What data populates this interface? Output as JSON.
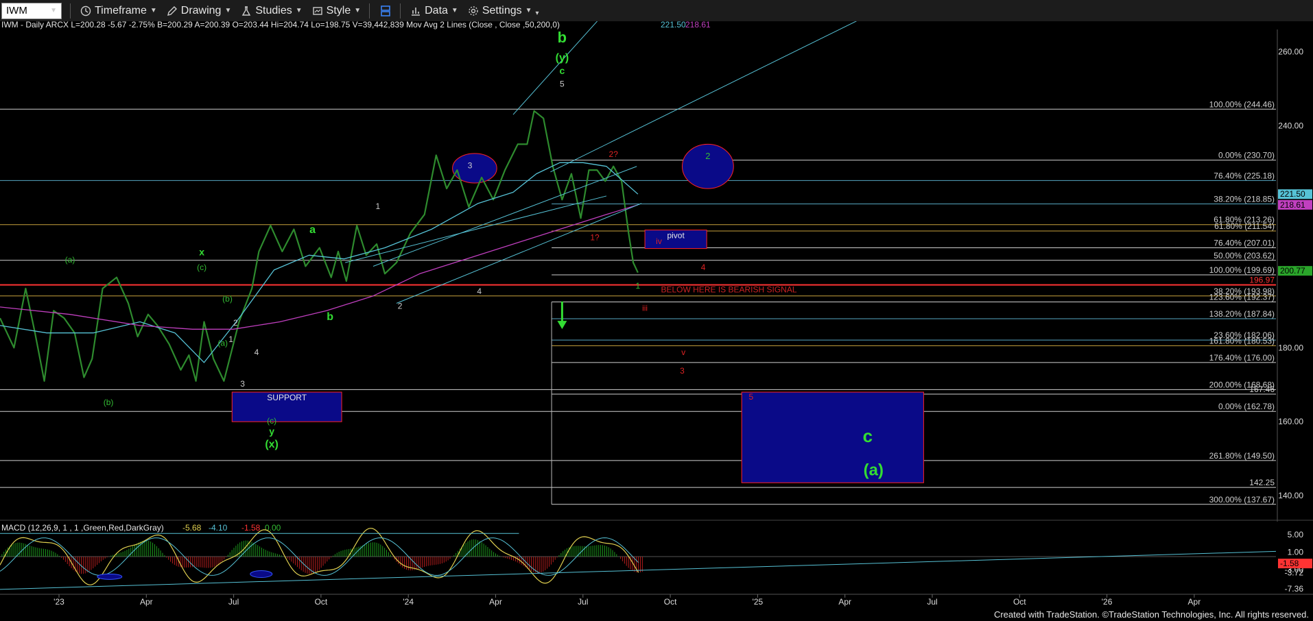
{
  "toolbar": {
    "symbol": "IWM",
    "timeframe_label": "Timeframe",
    "drawing_label": "Drawing",
    "studies_label": "Studies",
    "style_label": "Style",
    "data_label": "Data",
    "settings_label": "Settings"
  },
  "header": {
    "info_text": "IWM - Daily  ARCX  L=200.28  -5.67  -2.75%  B=200.29  A=200.39  O=203.44  Hi=204.74  Lo=198.75  V=39,442,839  Mov Avg 2 Lines (Close , Close ,50,200,0)",
    "ma50": "221.50",
    "ma200": "218.61"
  },
  "macd": {
    "label": "MACD (12,26,9, 1 , 1 ,Green,Red,DarkGray)",
    "v1": "-5.68",
    "v2": "-4.10",
    "v3": "-1.58",
    "v4": "0.00",
    "ticks": [
      "5.00",
      "1.00",
      "-3.72",
      "-3.00",
      "-7.36"
    ],
    "current": "-1.58"
  },
  "footer_text": "Created with TradeStation. ©TradeStation Technologies, Inc. All rights reserved.",
  "colors": {
    "background": "#000000",
    "price": "#2e8b2e",
    "ma50": "#56c2d6",
    "ma200": "#c03fbf",
    "support_fill": "#0a0a88",
    "red_line": "#ff3333"
  },
  "chart_data": {
    "type": "line",
    "title": "IWM - Daily",
    "ylim": [
      133,
      266
    ],
    "y_ticks": [
      260,
      240,
      180,
      160,
      140
    ],
    "x_labels": [
      "'23",
      "Apr",
      "Jul",
      "Oct",
      "'24",
      "Apr",
      "Jul",
      "Oct",
      "'25",
      "Apr",
      "Jul",
      "Oct",
      "'26",
      "Apr"
    ],
    "price_labels": [
      {
        "text": "221.50",
        "value": 221.5,
        "color": "#56c2d6"
      },
      {
        "text": "218.61",
        "value": 218.61,
        "color": "#c03fbf"
      },
      {
        "text": "200.77",
        "value": 200.77,
        "color": "#2aa52a"
      }
    ],
    "series": [
      {
        "name": "IWM",
        "color": "#2e8b2e",
        "points": [
          [
            0,
            188
          ],
          [
            12,
            180
          ],
          [
            22,
            196
          ],
          [
            30,
            184
          ],
          [
            38,
            171
          ],
          [
            46,
            190
          ],
          [
            55,
            188
          ],
          [
            64,
            184
          ],
          [
            72,
            172
          ],
          [
            79,
            177
          ],
          [
            88,
            196
          ],
          [
            100,
            199
          ],
          [
            110,
            192
          ],
          [
            118,
            183
          ],
          [
            127,
            189
          ],
          [
            135,
            186
          ],
          [
            145,
            181
          ],
          [
            155,
            174
          ],
          [
            162,
            178
          ],
          [
            168,
            171
          ],
          [
            175,
            187
          ],
          [
            183,
            177
          ],
          [
            192,
            171
          ],
          [
            205,
            187
          ],
          [
            216,
            196
          ],
          [
            222,
            206
          ],
          [
            232,
            213
          ],
          [
            242,
            206
          ],
          [
            252,
            212
          ],
          [
            262,
            202
          ],
          [
            274,
            207
          ],
          [
            284,
            199
          ],
          [
            290,
            206
          ],
          [
            297,
            198
          ],
          [
            306,
            213
          ],
          [
            314,
            205
          ],
          [
            323,
            208
          ],
          [
            330,
            200
          ],
          [
            340,
            203
          ],
          [
            352,
            211
          ],
          [
            364,
            216
          ],
          [
            374,
            232
          ],
          [
            383,
            223
          ],
          [
            392,
            228
          ],
          [
            402,
            218
          ],
          [
            413,
            226
          ],
          [
            423,
            220
          ],
          [
            433,
            228
          ],
          [
            444,
            235
          ],
          [
            452,
            235
          ],
          [
            458,
            244
          ],
          [
            466,
            242
          ],
          [
            474,
            229
          ],
          [
            482,
            220
          ],
          [
            490,
            227
          ],
          [
            498,
            215
          ],
          [
            505,
            228
          ],
          [
            512,
            228
          ],
          [
            519,
            225
          ],
          [
            526,
            229
          ],
          [
            533,
            225
          ],
          [
            539,
            211
          ],
          [
            543,
            203
          ],
          [
            547,
            200.3
          ]
        ]
      },
      {
        "name": "MA50",
        "color": "#56c2d6",
        "points": [
          [
            0,
            186
          ],
          [
            40,
            184
          ],
          [
            80,
            184
          ],
          [
            120,
            187
          ],
          [
            150,
            184
          ],
          [
            175,
            176
          ],
          [
            205,
            188
          ],
          [
            235,
            201
          ],
          [
            265,
            205
          ],
          [
            295,
            204
          ],
          [
            330,
            207
          ],
          [
            370,
            212
          ],
          [
            410,
            219
          ],
          [
            440,
            222
          ],
          [
            460,
            227
          ],
          [
            480,
            230
          ],
          [
            500,
            230
          ],
          [
            520,
            229
          ],
          [
            547,
            221.5
          ]
        ]
      },
      {
        "name": "MA200",
        "color": "#c03fbf",
        "points": [
          [
            0,
            191
          ],
          [
            60,
            189
          ],
          [
            120,
            186
          ],
          [
            165,
            185
          ],
          [
            200,
            185
          ],
          [
            240,
            187
          ],
          [
            280,
            190
          ],
          [
            320,
            194
          ],
          [
            360,
            200
          ],
          [
            400,
            204
          ],
          [
            440,
            208
          ],
          [
            480,
            212
          ],
          [
            520,
            216
          ],
          [
            547,
            218.6
          ]
        ]
      }
    ],
    "fib_lines": [
      {
        "label": "100.00% (244.46)",
        "value": 244.46,
        "start": 0,
        "color": "#cfcfcf"
      },
      {
        "label": "0.00% (230.70)",
        "value": 230.7,
        "start": 473,
        "color": "#cfcfcf"
      },
      {
        "label": "76.40% (225.18)",
        "value": 225.18,
        "start": 0,
        "color": "#56a7c2"
      },
      {
        "label": "38.20% (218.85)",
        "value": 218.85,
        "start": 473,
        "color": "#56a7c2"
      },
      {
        "label": "61.80% (213.26)",
        "value": 213.26,
        "start": 0,
        "color": "#c8a23c"
      },
      {
        "label": "61.80% (211.54)",
        "value": 211.54,
        "start": 473,
        "color": "#c8a23c"
      },
      {
        "label": "76.40% (207.01)",
        "value": 207.01,
        "start": 473,
        "color": "#cfcfcf"
      },
      {
        "label": "50.00% (203.62)",
        "value": 203.62,
        "start": 0,
        "color": "#cfcfcf"
      },
      {
        "label": "100.00% (199.69)",
        "value": 199.69,
        "start": 473,
        "color": "#cfcfcf"
      },
      {
        "label": "196.97",
        "value": 196.97,
        "start": 0,
        "color": "#ff3333"
      },
      {
        "label": "38.20% (193.98)",
        "value": 193.98,
        "start": 0,
        "color": "#c8a23c"
      },
      {
        "label": "123.60% (192.37)",
        "value": 192.37,
        "start": 473,
        "color": "#cfcfcf"
      },
      {
        "label": "138.20% (187.84)",
        "value": 187.84,
        "start": 473,
        "color": "#56a7c2"
      },
      {
        "label": "23.60% (182.06)",
        "value": 182.06,
        "start": 473,
        "color": "#56a7c2"
      },
      {
        "label": "161.80% (180.53)",
        "value": 180.53,
        "start": 473,
        "color": "#c8a23c"
      },
      {
        "label": "176.40% (176.00)",
        "value": 176,
        "start": 473,
        "color": "#cfcfcf"
      },
      {
        "label": "200.00% (168.68)",
        "value": 168.68,
        "start": 0,
        "color": "#cfcfcf"
      },
      {
        "label": "167.46",
        "value": 167.46,
        "start": 473,
        "color": "#cfcfcf"
      },
      {
        "label": "0.00% (162.78)",
        "value": 162.78,
        "start": 0,
        "color": "#cfcfcf"
      },
      {
        "label": "261.80% (149.50)",
        "value": 149.5,
        "start": 0,
        "color": "#cfcfcf"
      },
      {
        "label": "142.25",
        "value": 142.25,
        "start": 0,
        "color": "#cfcfcf"
      },
      {
        "label": "300.00% (137.67)",
        "value": 137.67,
        "start": 473,
        "color": "#cfcfcf"
      }
    ],
    "trend_lines": [
      {
        "from": [
          440,
          243
        ],
        "to": [
          580,
          292
        ],
        "color": "#56c2d6"
      },
      {
        "from": [
          472,
          227.5
        ],
        "to": [
          855,
          287
        ],
        "color": "#56c2d6"
      },
      {
        "from": [
          296,
          203
        ],
        "to": [
          520,
          221
        ],
        "color": "#56c2d6"
      },
      {
        "from": [
          320,
          202
        ],
        "to": [
          546,
          229
        ],
        "color": "#56c2d6"
      },
      {
        "from": [
          340,
          192
        ],
        "to": [
          550,
          219
        ],
        "color": "#56c2d6"
      }
    ],
    "boxes": [
      {
        "name": "support-box",
        "x1": 199,
        "x2": 293,
        "y1": 168,
        "y2": 160,
        "fill": "#0a0a88",
        "stroke": "#ff2222",
        "label": "SUPPORT"
      },
      {
        "name": "pivot-box",
        "x1": 553,
        "x2": 606,
        "y1": 211.8,
        "y2": 206.8,
        "fill": "#0a0a88",
        "stroke": "#ff2222",
        "label": "pivot"
      },
      {
        "name": "target-box",
        "x1": 636,
        "x2": 792,
        "y1": 168,
        "y2": 143.5,
        "fill": "#0a0a88",
        "stroke": "#ff2222",
        "label": ""
      }
    ],
    "ellipses": [
      {
        "name": "wave3-ellipse",
        "cx": 407,
        "cy": 228.5,
        "rx": 19,
        "ry": 4
      },
      {
        "name": "wave2-ellipse",
        "cx": 607,
        "cy": 229,
        "rx": 22,
        "ry": 6
      }
    ],
    "annotations": [
      {
        "text": "b",
        "x": 482,
        "y": 262.5,
        "color": "#33dd33",
        "size": 22,
        "bold": true
      },
      {
        "text": "(y)",
        "x": 482,
        "y": 257.5,
        "color": "#33dd33",
        "size": 16,
        "bold": true
      },
      {
        "text": "c",
        "x": 482,
        "y": 254,
        "color": "#33dd33",
        "size": 14,
        "bold": true
      },
      {
        "text": "5",
        "x": 482,
        "y": 250.5,
        "color": "#cccccc",
        "size": 12,
        "bold": false
      },
      {
        "text": "(a)",
        "x": 60,
        "y": 203,
        "color": "#33bb33",
        "size": 12,
        "bold": false
      },
      {
        "text": "x",
        "x": 173,
        "y": 205,
        "color": "#33dd33",
        "size": 14,
        "bold": true
      },
      {
        "text": "(c)",
        "x": 173,
        "y": 201,
        "color": "#33bb33",
        "size": 12,
        "bold": false
      },
      {
        "text": "(b)",
        "x": 195,
        "y": 192.5,
        "color": "#33bb33",
        "size": 12,
        "bold": false
      },
      {
        "text": "2",
        "x": 202,
        "y": 186,
        "color": "#cccccc",
        "size": 12,
        "bold": false
      },
      {
        "text": "(a)",
        "x": 191,
        "y": 180.5,
        "color": "#33bb33",
        "size": 12,
        "bold": false
      },
      {
        "text": "1",
        "x": 198,
        "y": 181.5,
        "color": "#cccccc",
        "size": 12,
        "bold": false
      },
      {
        "text": "4",
        "x": 220,
        "y": 178,
        "color": "#cccccc",
        "size": 12,
        "bold": false
      },
      {
        "text": "3",
        "x": 208,
        "y": 169.5,
        "color": "#cccccc",
        "size": 12,
        "bold": false
      },
      {
        "text": "(b)",
        "x": 93,
        "y": 164.5,
        "color": "#33bb33",
        "size": 12,
        "bold": false
      },
      {
        "text": "(c)",
        "x": 233,
        "y": 159.5,
        "color": "#33bb33",
        "size": 12,
        "bold": false
      },
      {
        "text": "y",
        "x": 233,
        "y": 156.5,
        "color": "#33dd33",
        "size": 14,
        "bold": true
      },
      {
        "text": "(x)",
        "x": 233,
        "y": 153,
        "color": "#33dd33",
        "size": 16,
        "bold": true
      },
      {
        "text": "a",
        "x": 268,
        "y": 211,
        "color": "#33dd33",
        "size": 16,
        "bold": true
      },
      {
        "text": "b",
        "x": 283,
        "y": 187.5,
        "color": "#33dd33",
        "size": 16,
        "bold": true
      },
      {
        "text": "1",
        "x": 324,
        "y": 217.5,
        "color": "#cccccc",
        "size": 12,
        "bold": false
      },
      {
        "text": "2",
        "x": 343,
        "y": 190.5,
        "color": "#cccccc",
        "size": 12,
        "bold": false
      },
      {
        "text": "3",
        "x": 403,
        "y": 228.5,
        "color": "#cccccc",
        "size": 12,
        "bold": false
      },
      {
        "text": "4",
        "x": 411,
        "y": 194.5,
        "color": "#cccccc",
        "size": 12,
        "bold": false
      },
      {
        "text": "2?",
        "x": 526,
        "y": 231.5,
        "color": "#dd2222",
        "size": 12,
        "bold": false
      },
      {
        "text": "1?",
        "x": 510,
        "y": 209,
        "color": "#dd2222",
        "size": 12,
        "bold": false
      },
      {
        "text": "iv",
        "x": 565,
        "y": 208,
        "color": "#dd2222",
        "size": 12,
        "bold": false
      },
      {
        "text": "4",
        "x": 603,
        "y": 201,
        "color": "#dd2222",
        "size": 12,
        "bold": false
      },
      {
        "text": "1",
        "x": 547,
        "y": 196,
        "color": "#33bb33",
        "size": 12,
        "bold": false
      },
      {
        "text": "BELOW HERE IS BEARISH SIGNAL",
        "x": 625,
        "y": 195,
        "color": "#cc2222",
        "size": 12,
        "bold": false
      },
      {
        "text": "iii",
        "x": 553,
        "y": 190,
        "color": "#dd2222",
        "size": 12,
        "bold": false
      },
      {
        "text": "v",
        "x": 586,
        "y": 178,
        "color": "#dd2222",
        "size": 12,
        "bold": false
      },
      {
        "text": "3",
        "x": 585,
        "y": 173,
        "color": "#dd2222",
        "size": 12,
        "bold": false
      },
      {
        "text": "5",
        "x": 644,
        "y": 166,
        "color": "#dd2222",
        "size": 12,
        "bold": false
      },
      {
        "text": "2",
        "x": 607,
        "y": 231,
        "color": "#33bb33",
        "size": 13,
        "bold": false
      },
      {
        "text": "c",
        "x": 744,
        "y": 154.5,
        "color": "#33dd33",
        "size": 26,
        "bold": true
      },
      {
        "text": "(a)",
        "x": 749,
        "y": 145.5,
        "color": "#33dd33",
        "size": 24,
        "bold": true
      }
    ],
    "arrow": {
      "x": 482,
      "from": 192.5,
      "to": 186.5,
      "color": "#33dd33"
    }
  }
}
